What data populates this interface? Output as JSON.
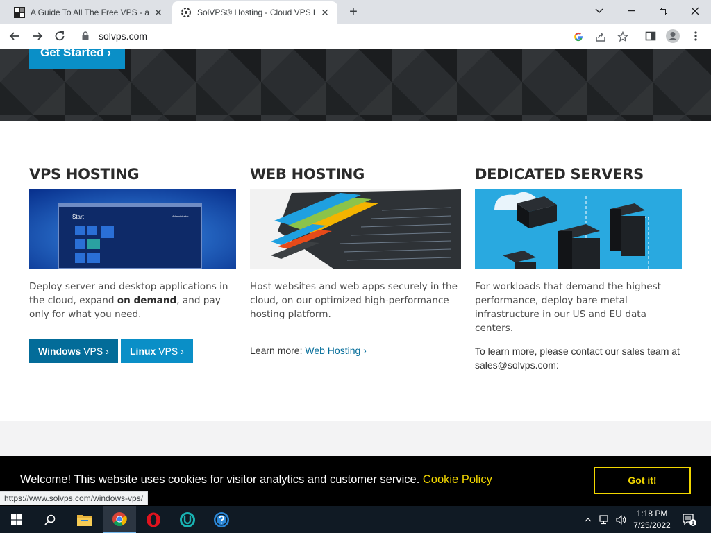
{
  "browser": {
    "tabs": [
      {
        "title": "A Guide To All The Free VPS - and",
        "close": "✕",
        "active": false
      },
      {
        "title": "SolVPS® Hosting - Cloud VPS Ho",
        "close": "✕",
        "active": true
      }
    ],
    "new_tab": "+",
    "address": "solvps.com",
    "status_url": "https://www.solvps.com/windows-vps/"
  },
  "hero": {
    "cta": "Get Started ›"
  },
  "columns": [
    {
      "title": "VPS HOSTING",
      "start_label": "Start",
      "user_label": "Administrator",
      "text_before": "Deploy server and desktop applications in the cloud, expand ",
      "text_bold": "on demand",
      "text_after": ", and pay only for what you need.",
      "buttons": [
        {
          "bold": "Windows",
          "rest": " VPS ›"
        },
        {
          "bold": "Linux",
          "rest": " VPS ›"
        }
      ]
    },
    {
      "title": "WEB HOSTING",
      "text": "Host websites and web apps securely in the cloud, on our optimized high-performance hosting platform.",
      "learn_prefix": "Learn more: ",
      "learn_link": "Web Hosting ›"
    },
    {
      "title": "DEDICATED SERVERS",
      "text": "For workloads that demand the highest performance, deploy bare metal infrastructure in our US and EU data centers.",
      "contact": "To learn more, please contact our sales team at sales@solvps.com:"
    }
  ],
  "cookie": {
    "message": "Welcome! This website uses cookies for visitor analytics and customer service. ",
    "link": "Cookie Policy",
    "button": "Got it!"
  },
  "taskbar": {
    "time": "1:18 PM",
    "date": "7/25/2022",
    "notification_count": "1"
  },
  "colors": {
    "brand_blue": "#0a8fc7",
    "brand_dark_blue": "#036c99",
    "cookie_accent": "#f1d600"
  }
}
